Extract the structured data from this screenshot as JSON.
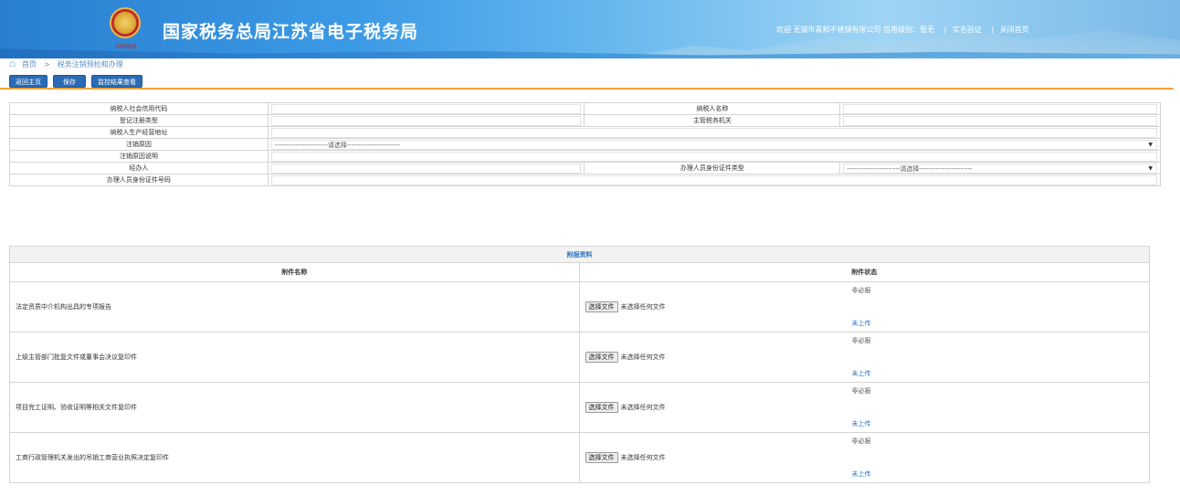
{
  "header": {
    "site_title": "国家税务总局江苏省电子税务局",
    "emblem_caption": "中国税务",
    "welcome": "欢迎 无锡市青和不锈钢有限公司  信用级别：暂无",
    "link_verify": "实名验证",
    "link_close": "关闭首页"
  },
  "breadcrumb": {
    "home": "首页",
    "separator": ">",
    "current": "税务注销预检和办理"
  },
  "toolbar": {
    "back_label": "返回主页",
    "save_label": "保存",
    "check_label": "监控结果查看"
  },
  "form": {
    "credit_code_label": "纳税人社会信用代码",
    "taxpayer_name_label": "纳税人名称",
    "reg_type_label": "登记注册类型",
    "tax_authority_label": "主管税务机关",
    "address_label": "纳税人生产经营地址",
    "reason_label": "注销原因",
    "reason_placeholder": "-----------------------请选择-----------------------",
    "reason_desc_label": "注销原因说明",
    "handler_label": "经办人",
    "id_type_label": "办理人员身份证件类型",
    "id_type_placeholder": "-----------------------请选择-----------------------",
    "id_number_label": "办理人员身份证件号码"
  },
  "attachments": {
    "title": "附报资料",
    "col_name": "附件名称",
    "col_status": "附件状态",
    "file_button": "选择文件",
    "no_file_text": "未选择任何文件",
    "rows": [
      {
        "name": "法定资质中介机构出具的专项报告",
        "required": "非必报",
        "status": "未上传"
      },
      {
        "name": "上级主管部门批复文件或董事会决议复印件",
        "required": "非必报",
        "status": "未上传"
      },
      {
        "name": "项目完工证明、验收证明等相关文件复印件",
        "required": "非必报",
        "status": "未上传"
      },
      {
        "name": "工商行政管理机关发出的吊销工商营业执照决定复印件",
        "required": "非必报",
        "status": "未上传"
      }
    ]
  },
  "colors": {
    "accent": "#2a6bb5",
    "toolbar_border": "#f1a33c",
    "link": "#2a73c2"
  }
}
